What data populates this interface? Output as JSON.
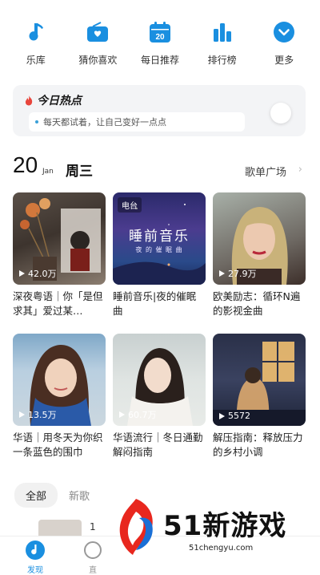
{
  "quicknav": [
    {
      "label": "乐库",
      "icon": "music-note-icon"
    },
    {
      "label": "猜你喜欢",
      "icon": "radio-icon"
    },
    {
      "label": "每日推荐",
      "icon": "calendar-icon"
    },
    {
      "label": "排行榜",
      "icon": "bar-chart-icon"
    },
    {
      "label": "更多",
      "icon": "chevron-down-circle-icon"
    }
  ],
  "daily_date": "20",
  "hot": {
    "title": "今日热点",
    "text": "每天都试着，让自己变好一点点"
  },
  "date_row": {
    "day": "20",
    "month": "Jan",
    "weekday": "周三",
    "plaza_label": "歌单广场",
    "plaza_arrow": "›"
  },
  "playlists": [
    {
      "title": "深夜粤语｜你「是但求其」爱过某…",
      "plays": "42.0万",
      "tag": ""
    },
    {
      "title": "睡前音乐|夜的催眠曲",
      "plays": "",
      "tag": "电台",
      "cover_text": "睡前音乐",
      "cover_sub": "夜 的 催 眠 曲"
    },
    {
      "title": "欧美励志：循环N遍的影视金曲",
      "plays": "27.9万",
      "tag": ""
    },
    {
      "title": "华语｜用冬天为你织一条蓝色的围巾",
      "plays": "13.5万",
      "tag": ""
    },
    {
      "title": "华语流行｜冬日通勤解闷指南",
      "plays": "60.7万",
      "tag": ""
    },
    {
      "title": "解压指南：释放压力的乡村小调",
      "plays": "5572",
      "tag": ""
    }
  ],
  "filters": {
    "active": "全部",
    "next": "新歌"
  },
  "peek": {
    "text": "1"
  },
  "tabbar": [
    {
      "label": "发现",
      "icon": "discover-icon",
      "active": true
    },
    {
      "label": "直",
      "icon": "live-icon",
      "active": false
    }
  ],
  "watermark": {
    "text": "51新游戏",
    "url": "51chengyu.com"
  },
  "colors": {
    "accent": "#1a8fe0",
    "hot": "#e8453c"
  }
}
